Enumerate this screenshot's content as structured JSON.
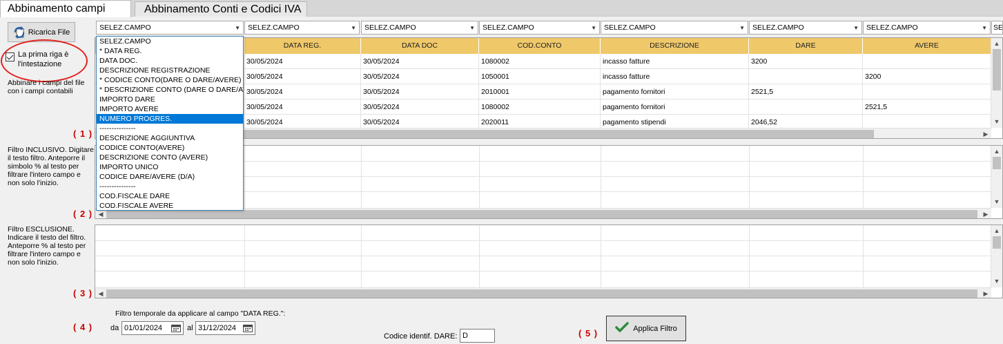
{
  "tabs": [
    {
      "label": "Abbinamento campi",
      "active": true
    },
    {
      "label": "Abbinamento Conti e Codici IVA",
      "active": false
    }
  ],
  "sidebar": {
    "reload_label": "Ricarica File",
    "first_row_header_label": "La prima riga è l'intestazione",
    "first_row_header_checked": true,
    "match_fields_text": "Abbinare i campi del file con i campi contabili",
    "step1": "( 1 )",
    "filter_include_text": "Filtro  INCLUSIVO. Digitare il testo filtro. Anteporre il simbolo % al testo per filtrare l'intero campo e non solo l'inizio.",
    "step2": "( 2 )",
    "filter_exclude_text": "Filtro ESCLUSIONE. Indicare il testo del filtro. Anteporre % al testo per filtrare l'intero campo e non solo l'inizio.",
    "step3": "( 3 )",
    "step4": "( 4 )",
    "step5": "( 5 )"
  },
  "combos": [
    "SELEZ.CAMPO",
    "SELEZ.CAMPO",
    "SELEZ.CAMPO",
    "SELEZ.CAMPO",
    "SELEZ.CAMPO",
    "SELEZ.CAMPO",
    "SELEZ.CAMPO",
    "SELEZ"
  ],
  "dropdown": {
    "items": [
      "SELEZ.CAMPO",
      "* DATA REG.",
      "DATA DOC.",
      "DESCRIZIONE REGISTRAZIONE",
      "* CODICE CONTO(DARE O DARE/AVERE)",
      "* DESCRIZIONE CONTO (DARE O DARE/AVERE)",
      "IMPORTO DARE",
      "IMPORTO AVERE",
      "NUMERO PROGRES.",
      "---------------",
      "DESCRIZIONE AGGIUNTIVA",
      "CODICE CONTO(AVERE)",
      "DESCRIZIONE CONTO (AVERE)",
      "IMPORTO UNICO",
      "CODICE DARE/AVERE (D/A)",
      "---------------",
      "COD.FISCALE DARE",
      "COD.FISCALE AVERE"
    ],
    "selected_index": 8
  },
  "grid": {
    "columns": [
      "",
      "DATA REG.",
      "DATA DOC",
      "COD.CONTO",
      "DESCRIZIONE",
      "DARE",
      "AVERE"
    ],
    "rows": [
      [
        "",
        "30/05/2024",
        "30/05/2024",
        "1080002",
        "incasso fatture",
        "3200",
        ""
      ],
      [
        "",
        "30/05/2024",
        "30/05/2024",
        "1050001",
        "incasso fatture",
        "",
        "3200"
      ],
      [
        "",
        "30/05/2024",
        "30/05/2024",
        "2010001",
        "pagamento fornitori",
        "2521,5",
        ""
      ],
      [
        "",
        "30/05/2024",
        "30/05/2024",
        "1080002",
        "pagamento fornitori",
        "",
        "2521,5"
      ],
      [
        "",
        "30/05/2024",
        "30/05/2024",
        "2020011",
        "pagamento stipendi",
        "2046,52",
        ""
      ]
    ]
  },
  "date_filter": {
    "label": "Filtro temporale da applicare al campo \"DATA REG.\":",
    "from_label": "da",
    "from_value": "01/01/2024",
    "to_label": "al",
    "to_value": "31/12/2024"
  },
  "code_dare": {
    "label": "Codice identif. DARE:",
    "value": "D"
  },
  "apply_label": "Applica Filtro",
  "colors": {
    "header_bg": "#efc86a",
    "selection": "#0078d7",
    "step_red": "#cc0000",
    "highlight_ellipse": "#e1201d",
    "check_green": "#2e8b3c"
  }
}
